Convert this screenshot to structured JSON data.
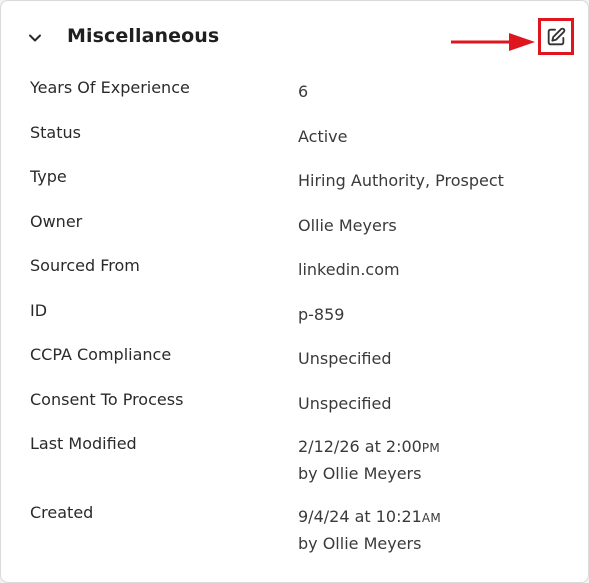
{
  "section": {
    "title": "Miscellaneous"
  },
  "fields": [
    {
      "label": "Years Of Experience",
      "value": "6"
    },
    {
      "label": "Status",
      "value": "Active"
    },
    {
      "label": "Type",
      "value": "Hiring Authority, Prospect"
    },
    {
      "label": "Owner",
      "value": "Ollie Meyers"
    },
    {
      "label": "Sourced From",
      "value": "linkedin.com"
    },
    {
      "label": "ID",
      "value": "p-859"
    },
    {
      "label": "CCPA Compliance",
      "value": "Unspecified"
    },
    {
      "label": "Consent To Process",
      "value": "Unspecified"
    }
  ],
  "last_modified": {
    "label": "Last Modified",
    "datetime": "2/12/26 at 2:00",
    "ampm": "PM",
    "by": "by Ollie Meyers"
  },
  "created": {
    "label": "Created",
    "datetime": "9/4/24 at 10:21",
    "ampm": "AM",
    "by": "by Ollie Meyers"
  },
  "icons": {
    "collapse": "chevron-down-icon",
    "edit": "edit-icon",
    "annotation": "arrow-right-icon"
  },
  "colors": {
    "annotation_red": "#e0161f",
    "text_dark": "#1f1f1f",
    "text_value": "#3a3a3a"
  }
}
